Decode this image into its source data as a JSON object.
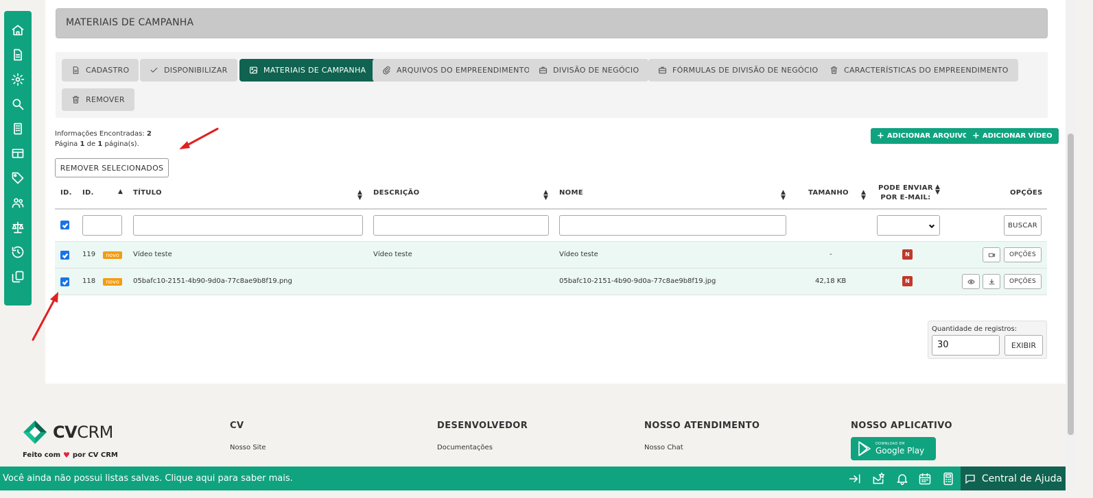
{
  "sidebar": {
    "items": [
      {
        "icon": "home-icon"
      },
      {
        "icon": "document-icon"
      },
      {
        "icon": "gear-icon"
      },
      {
        "icon": "search-icon"
      },
      {
        "icon": "building-icon"
      },
      {
        "icon": "table-icon"
      },
      {
        "icon": "tag-icon"
      },
      {
        "icon": "users-icon"
      },
      {
        "icon": "scale-icon"
      },
      {
        "icon": "history-icon"
      },
      {
        "icon": "copy-icon"
      }
    ]
  },
  "header": {
    "title": "MATERIAIS DE CAMPANHA"
  },
  "tabs": [
    {
      "label": "CADASTRO",
      "icon": "file-icon"
    },
    {
      "label": "DISPONIBILIZAR",
      "icon": "check-icon"
    },
    {
      "label": "MATERIAIS DE CAMPANHA",
      "icon": "image-icon",
      "active": true
    },
    {
      "label": "ARQUIVOS DO EMPREENDIMENTO",
      "icon": "paperclip-icon"
    },
    {
      "label": "DIVISÃO DE NEGÓCIO",
      "icon": "briefcase-icon"
    },
    {
      "label": "FÓRMULAS DE DIVISÃO DE NEGÓCIO",
      "icon": "briefcase-icon"
    },
    {
      "label": "CARACTERÍSTICAS DO EMPREENDIMENTO",
      "icon": "trash-icon"
    },
    {
      "label": "REMOVER",
      "icon": "trash-icon"
    }
  ],
  "info": {
    "found_label": "Informações Encontradas:",
    "found_count": "2",
    "page_prefix": "Página",
    "page_current": "1",
    "page_of": "de",
    "page_total": "1",
    "page_suffix": "página(s)."
  },
  "actions": {
    "remove_selected": "REMOVER SELECIONADOS",
    "add_file": "ADICIONAR ARQUIVO",
    "add_video": "ADICIONAR VÍDEO"
  },
  "table": {
    "headers": {
      "select": "ID.",
      "id": "ID.",
      "title": "TÍTULO",
      "description": "DESCRIÇÃO",
      "name": "NOME",
      "size": "TAMANHO",
      "email_line1": "PODE ENVIAR",
      "email_line2": "POR E-MAIL:",
      "options": "OPÇÕES"
    },
    "search_button": "BUSCAR",
    "rows": [
      {
        "checked": true,
        "id": "119",
        "badge": "novo",
        "title": "Vídeo teste",
        "description": "Vídeo teste",
        "name": "Vídeo teste",
        "size": "-",
        "email": "N",
        "options": "OPÇÕES"
      },
      {
        "checked": true,
        "id": "118",
        "badge": "novo",
        "title": "05bafc10-2151-4b90-9d0a-77c8ae9b8f19.png",
        "description": "",
        "name": "05bafc10-2151-4b90-9d0a-77c8ae9b8f19.jpg",
        "size": "42,18 KB",
        "email": "N",
        "options": "OPÇÕES"
      }
    ]
  },
  "pagination": {
    "qty_label": "Quantidade de registros:",
    "qty_value": "30",
    "show_button": "EXIBIR"
  },
  "footer": {
    "brand_bold": "CV",
    "brand_light": "CRM",
    "made_by_prefix": "Feito com",
    "made_by_suffix": "por CV CRM",
    "columns": [
      {
        "title": "CV",
        "link": "Nosso Site"
      },
      {
        "title": "DESENVOLVEDOR",
        "link": "Documentações"
      },
      {
        "title": "NOSSO ATENDIMENTO",
        "link": "Nosso Chat"
      },
      {
        "title": "NOSSO APLICATIVO",
        "link": ""
      }
    ],
    "app_badge_small": "DOWNLOAD EM",
    "app_badge_big": "Google Play"
  },
  "bottom_bar": {
    "message": "Você ainda não possui listas salvas. Clique aqui para saber mais.",
    "help_label": "Central de Ajuda"
  },
  "colors": {
    "brand_green": "#10a37f",
    "dark_green": "#0f6350",
    "badge_orange": "#f39c12",
    "badge_red": "#c0392b"
  }
}
